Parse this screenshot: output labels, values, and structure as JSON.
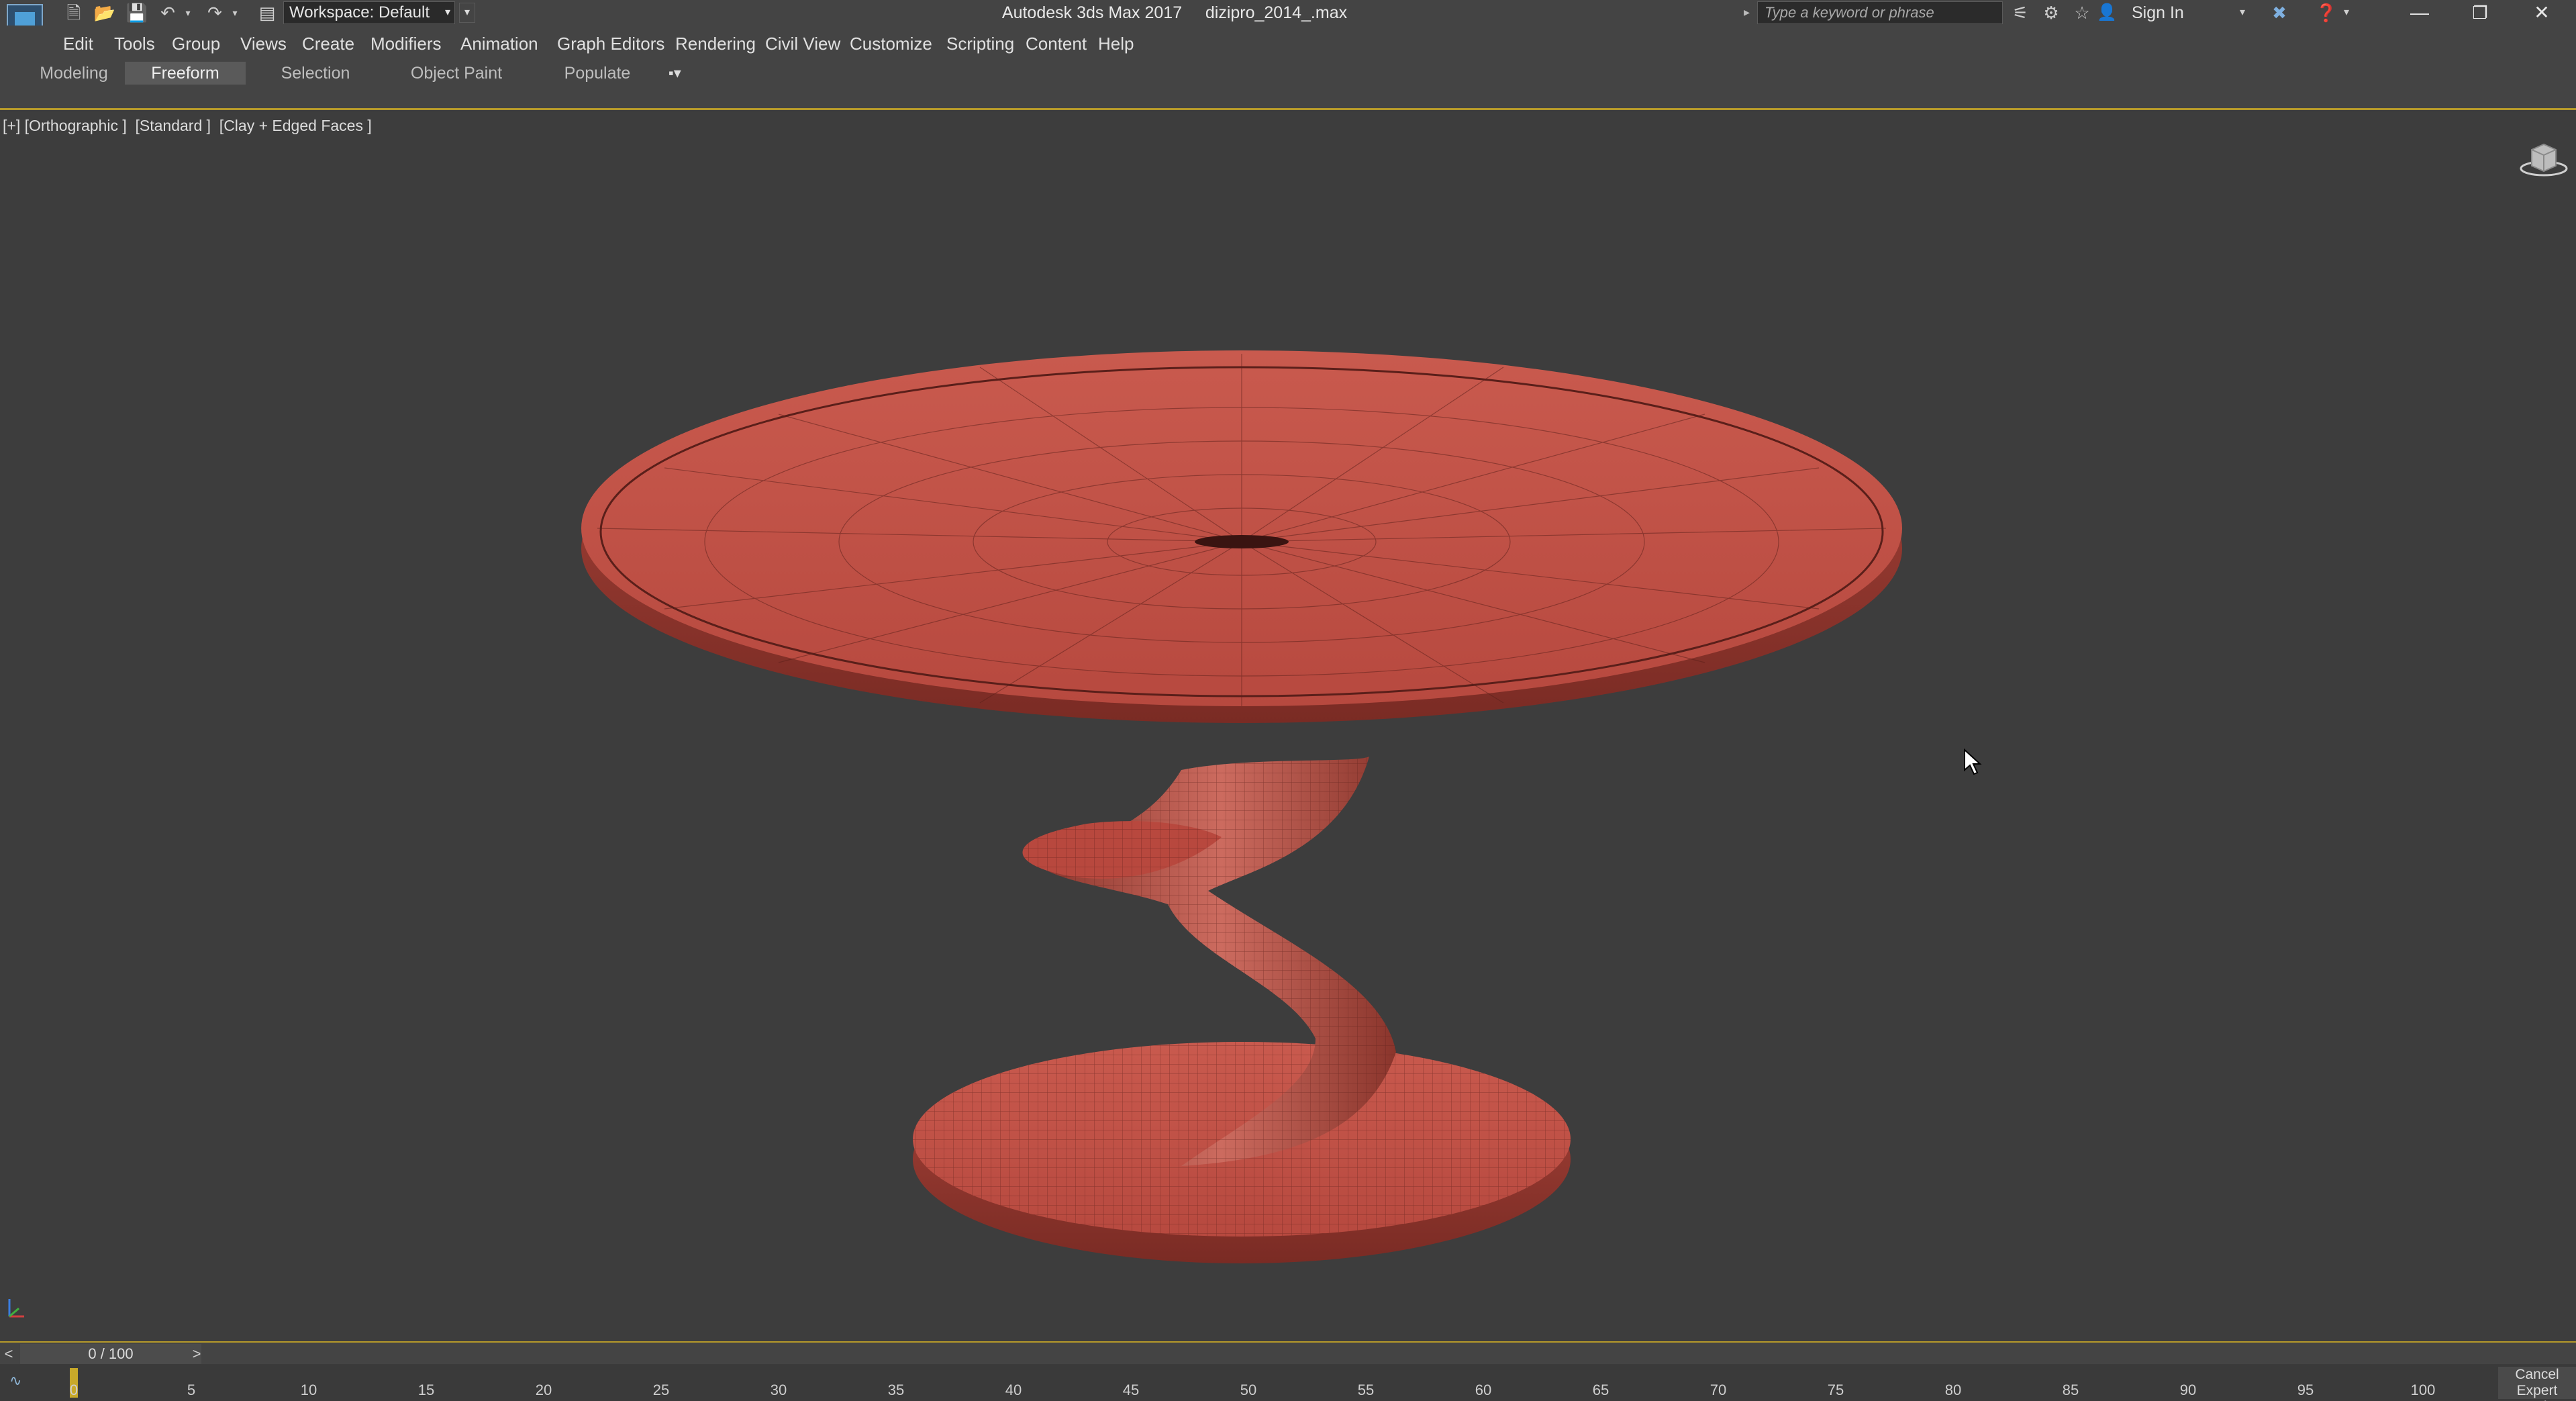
{
  "titlebar": {
    "workspace_label": "Workspace: Default",
    "app_title": "Autodesk 3ds Max 2017",
    "file_name": "dizipro_2014_.max",
    "search_placeholder": "Type a keyword or phrase",
    "sign_in": "Sign In"
  },
  "menu": {
    "items": [
      "Edit",
      "Tools",
      "Group",
      "Views",
      "Create",
      "Modifiers",
      "Animation",
      "Graph Editors",
      "Rendering",
      "Civil View",
      "Customize",
      "Scripting",
      "Content",
      "Help"
    ]
  },
  "ribbon": {
    "tabs": [
      "Modeling",
      "Freeform",
      "Selection",
      "Object Paint",
      "Populate"
    ],
    "active_tab": "Freeform"
  },
  "viewport": {
    "label": "[+] [Orthographic ]  [Standard ]  [Clay + Edged Faces ]",
    "object_color": "#c0564b",
    "background": "#3d3d3d"
  },
  "timeline": {
    "prev": "<",
    "next": ">",
    "frame_readout": "0 / 100",
    "current_frame": 0,
    "ticks": [
      "0",
      "5",
      "10",
      "15",
      "20",
      "25",
      "30",
      "35",
      "40",
      "45",
      "50",
      "55",
      "60",
      "65",
      "70",
      "75",
      "80",
      "85",
      "90",
      "95",
      "100"
    ],
    "cancel_label": "Cancel",
    "expert_mode_label": "Expert Mode"
  },
  "colors": {
    "accent_line": "#b69a2a",
    "chrome": "#444444"
  }
}
